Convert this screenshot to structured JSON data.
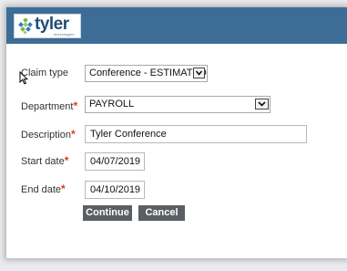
{
  "brand": {
    "name": "tyler",
    "tagline": "technologies"
  },
  "form": {
    "claim_type": {
      "label": "Claim type",
      "value": "Conference - ESTIMATED"
    },
    "department": {
      "label": "Department",
      "value": "PAYROLL"
    },
    "description": {
      "label": "Description",
      "value": "Tyler Conference"
    },
    "start_date": {
      "label": "Start date",
      "value": "04/07/2019"
    },
    "end_date": {
      "label": "End date",
      "value": "04/10/2019"
    },
    "required_marker": "*"
  },
  "buttons": {
    "continue": "Continue",
    "cancel": "Cancel"
  },
  "colors": {
    "header": "#3d6d96",
    "required": "#e03a1a",
    "button": "#5b5e63"
  },
  "icons": [
    "tyler-logo-icon",
    "chevron-down-icon",
    "mouse-pointer-icon"
  ]
}
